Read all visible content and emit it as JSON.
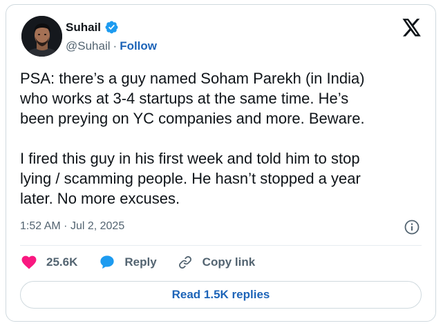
{
  "author": {
    "name": "Suhail",
    "handle": "@Suhail",
    "separator": "·",
    "follow_label": "Follow",
    "verified_color": "#1d9bf0"
  },
  "tweet": {
    "paragraphs": [
      "PSA: there’s a guy named Soham Parekh (in India)\nwho works at 3-4 startups at the same time. He’s\nbeen preying on YC companies and more. Beware.",
      "I fired this guy in his first week and told him to stop\nlying / scamming people. He hasn’t stopped a year\nlater. No more excuses."
    ],
    "time": "1:52 AM",
    "date_separator": "·",
    "date": "Jul 2, 2025"
  },
  "actions": {
    "likes": "25.6K",
    "reply_label": "Reply",
    "copy_link_label": "Copy link",
    "like_color": "#f91880",
    "reply_color": "#1d9bf0"
  },
  "replies_button": {
    "label": "Read 1.5K replies"
  },
  "icons": {
    "x_logo": "x-logo-icon",
    "info": "info-icon",
    "heart": "heart-icon",
    "reply": "speech-bubble-icon",
    "link": "link-icon",
    "verified": "verified-badge-icon"
  }
}
